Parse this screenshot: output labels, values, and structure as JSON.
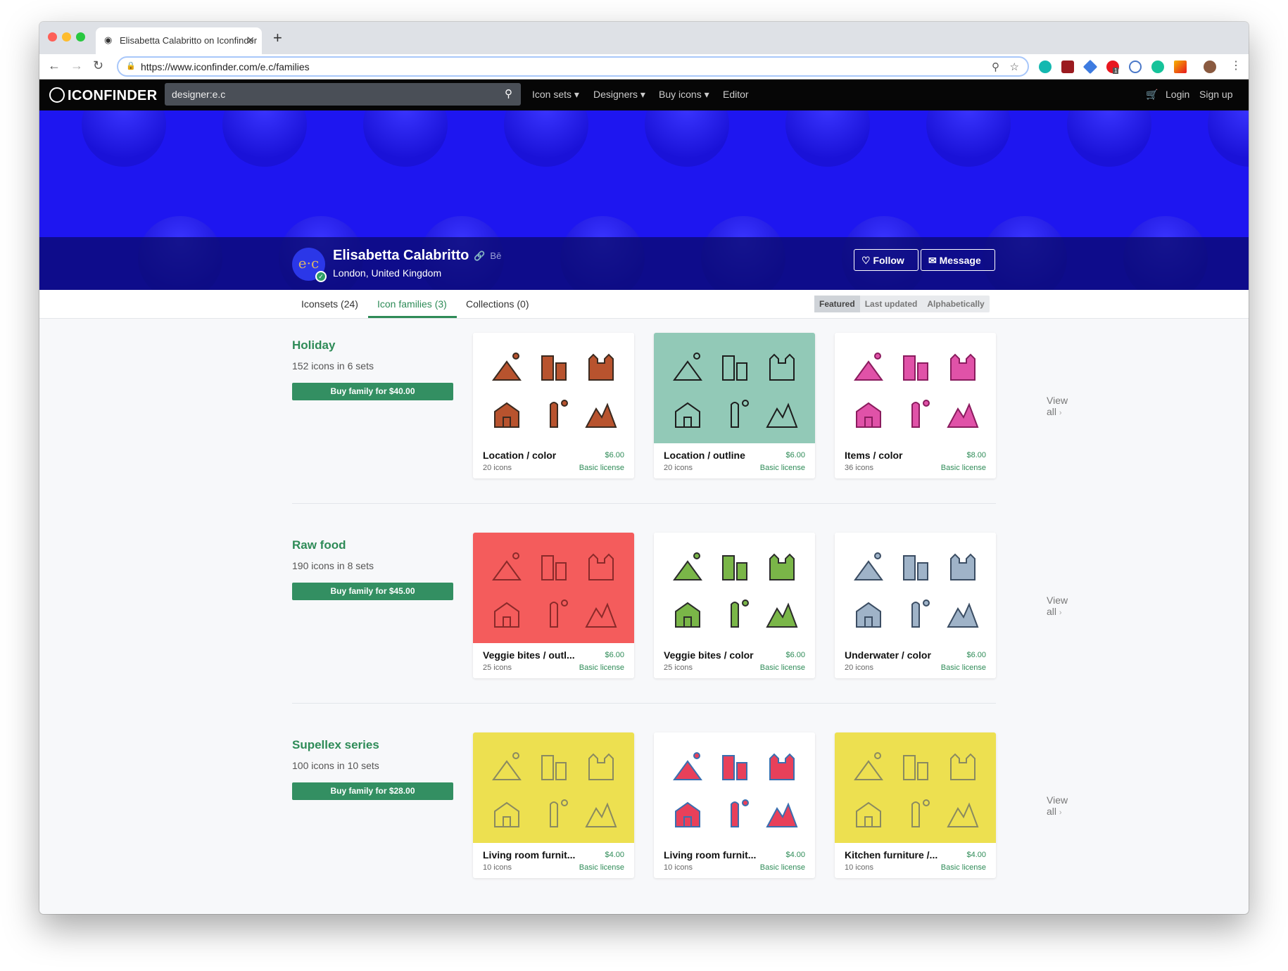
{
  "browser": {
    "tab_title": "Elisabetta Calabritto on Iconfinder",
    "url": "https://www.iconfinder.com/e.c/families",
    "ext_badge": "1"
  },
  "site": {
    "logo": "ICONFINDER",
    "search_value": "designer:e.c",
    "menu": [
      "Icon sets ▾",
      "Designers ▾",
      "Buy icons ▾",
      "Editor"
    ],
    "login": "Login",
    "signup": "Sign up"
  },
  "profile": {
    "initials": "e·c",
    "name": "Elisabetta Calabritto",
    "behance": "Bē",
    "location": "London, United Kingdom",
    "follow": "Follow",
    "message": "Message"
  },
  "tabs": [
    {
      "label": "Iconsets (24)"
    },
    {
      "label": "Icon families (3)"
    },
    {
      "label": "Collections (0)"
    }
  ],
  "sort": [
    "Featured",
    "Last updated",
    "Alphabetically"
  ],
  "view_all": "View all",
  "families": [
    {
      "title": "Holiday",
      "subtitle": "152 icons in 6 sets",
      "buy": "Buy family for $40.00",
      "cards": [
        {
          "name": "Location / color",
          "price": "$6.00",
          "count": "20 icons",
          "license": "Basic license",
          "bg": "#ffffff",
          "fill": "#b8532e",
          "stroke": "#3a2a20"
        },
        {
          "name": "Location / outline",
          "price": "$6.00",
          "count": "20 icons",
          "license": "Basic license",
          "bg": "#92c9b7",
          "fill": "none",
          "stroke": "#1d1d1d"
        },
        {
          "name": "Items / color",
          "price": "$8.00",
          "count": "36 icons",
          "license": "Basic license",
          "bg": "#ffffff",
          "fill": "#e052a8",
          "stroke": "#8a1c5e"
        }
      ]
    },
    {
      "title": "Raw food",
      "subtitle": "190 icons in 8 sets",
      "buy": "Buy family for $45.00",
      "cards": [
        {
          "name": "Veggie bites / outl...",
          "price": "$6.00",
          "count": "25 icons",
          "license": "Basic license",
          "bg": "#f45c5c",
          "fill": "none",
          "stroke": "#8a2a2a"
        },
        {
          "name": "Veggie bites / color",
          "price": "$6.00",
          "count": "25 icons",
          "license": "Basic license",
          "bg": "#ffffff",
          "fill": "#7ab648",
          "stroke": "#2b2b2b"
        },
        {
          "name": "Underwater / color",
          "price": "$6.00",
          "count": "20 icons",
          "license": "Basic license",
          "bg": "#ffffff",
          "fill": "#9fb3c8",
          "stroke": "#3b4d63"
        }
      ]
    },
    {
      "title": "Supellex series",
      "subtitle": "100 icons in 10 sets",
      "buy": "Buy family for $28.00",
      "cards": [
        {
          "name": "Living room furnit...",
          "price": "$4.00",
          "count": "10 icons",
          "license": "Basic license",
          "bg": "#ede050",
          "fill": "none",
          "stroke": "#8a8a60"
        },
        {
          "name": "Living room furnit...",
          "price": "$4.00",
          "count": "10 icons",
          "license": "Basic license",
          "bg": "#ffffff",
          "fill": "#e8405a",
          "stroke": "#3a6fb0"
        },
        {
          "name": "Kitchen furniture /...",
          "price": "$4.00",
          "count": "10 icons",
          "license": "Basic license",
          "bg": "#ede050",
          "fill": "none",
          "stroke": "#8a8a60"
        }
      ]
    }
  ]
}
